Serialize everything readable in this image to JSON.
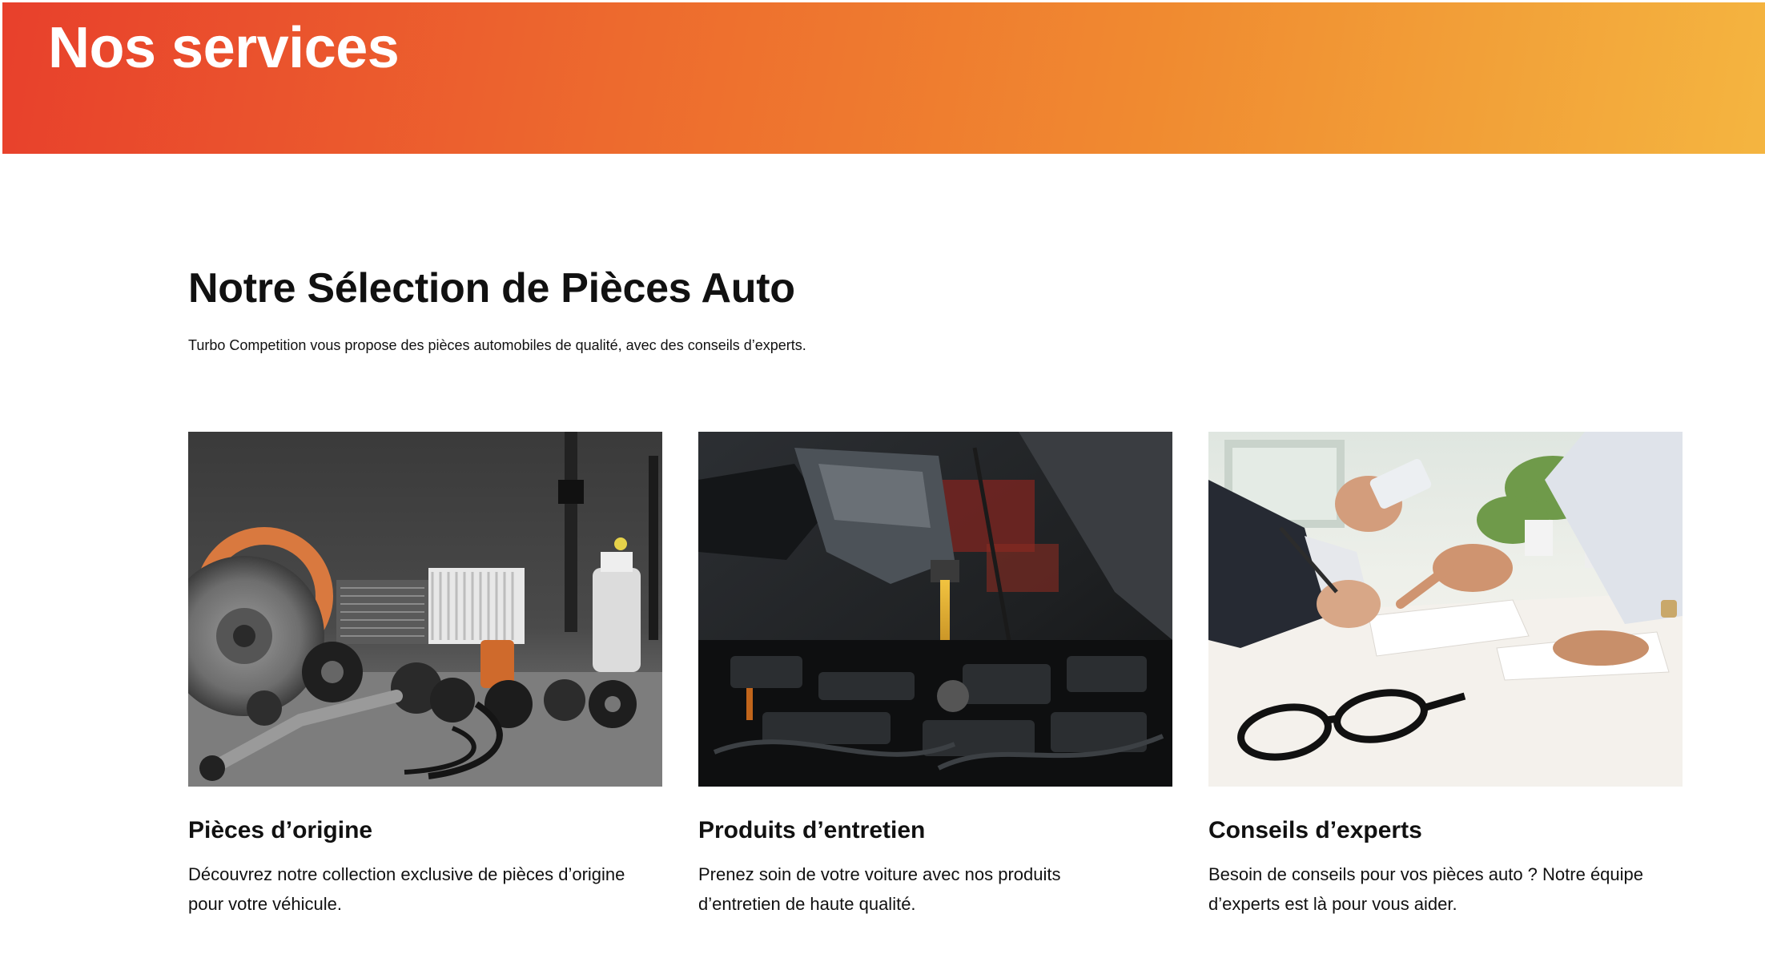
{
  "header": {
    "title": "Nos services",
    "gradient_colors": [
      "#e8402c",
      "#f4b540"
    ]
  },
  "section": {
    "title": "Notre Sélection de Pièces Auto",
    "subtitle": "Turbo Competition vous propose des pièces automobiles de qualité, avec des conseils d’experts."
  },
  "cards": [
    {
      "image": "car-parts-photo",
      "title": "Pièces d’origine",
      "description": "Découvrez notre collection exclusive de pièces d’origine pour votre véhicule."
    },
    {
      "image": "engine-oil-pouring-photo",
      "title": "Produits d’entretien",
      "description": "Prenez soin de votre voiture avec nos produits d’entretien de haute qualité."
    },
    {
      "image": "experts-meeting-photo",
      "title": "Conseils d’experts",
      "description": "Besoin de conseils pour vos pièces auto ? Notre équipe d’experts est là pour vous aider."
    }
  ]
}
